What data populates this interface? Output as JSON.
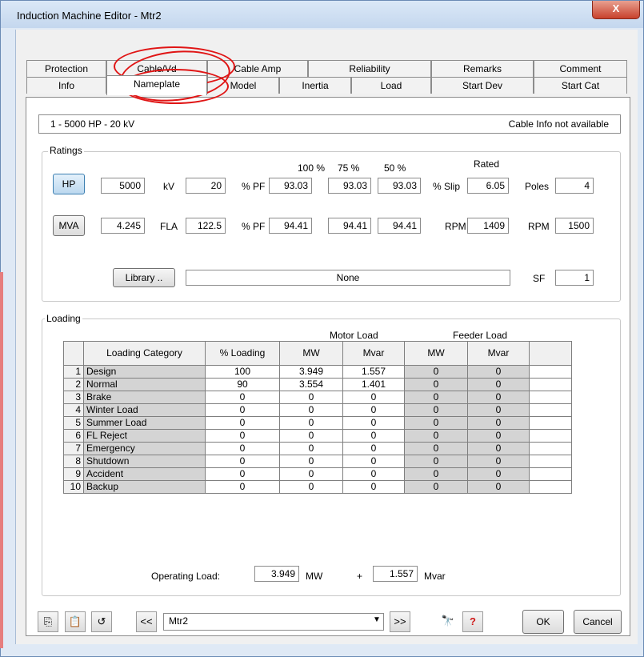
{
  "window": {
    "title": "Induction Machine Editor - Mtr2",
    "close_label": "X"
  },
  "tabs_row1": [
    "Protection",
    "Cable/Vd",
    "Cable Amp",
    "Reliability",
    "Remarks",
    "Comment"
  ],
  "tabs_row2": [
    "Info",
    "Nameplate",
    "Model",
    "Inertia",
    "Load",
    "Start Dev",
    "Start Cat"
  ],
  "active_tab": "Nameplate",
  "info_bar": {
    "left": "1 - 5000 HP - 20 kV",
    "right": "Cable Info not available"
  },
  "ratings": {
    "label": "Ratings",
    "hp_button": "HP",
    "hp_value": "5000",
    "kv_label": "kV",
    "kv_value": "20",
    "col_100": "100 %",
    "col_75": "75 %",
    "col_50": "50 %",
    "rated_label": "Rated",
    "pf_eff_label": "% PF",
    "eff_100": "93.03",
    "eff_75": "93.03",
    "eff_50": "93.03",
    "slip_label": "% Slip",
    "slip_value": "6.05",
    "poles_label": "Poles",
    "poles_value": "4",
    "mva_button": "MVA",
    "mva_value": "4.245",
    "fla_label": "FLA",
    "fla_value": "122.5",
    "pf_label": "% PF",
    "pf_100": "94.41",
    "pf_75": "94.41",
    "pf_50": "94.41",
    "rpm_label": "RPM",
    "rpm_value": "1409",
    "sync_rpm_label": "RPM",
    "sync_rpm_value": "1500",
    "library_button": "Library ..",
    "library_value": "None",
    "sf_label": "SF",
    "sf_value": "1"
  },
  "loading": {
    "label": "Loading",
    "motor_load_label": "Motor Load",
    "feeder_load_label": "Feeder Load",
    "columns": [
      "Loading Category",
      "% Loading",
      "MW",
      "Mvar",
      "MW",
      "Mvar"
    ],
    "rows": [
      {
        "n": "1",
        "cat": "Design",
        "pct": "100",
        "mw": "3.949",
        "mvar": "1.557",
        "fmw": "0",
        "fmvar": "0"
      },
      {
        "n": "2",
        "cat": "Normal",
        "pct": "90",
        "mw": "3.554",
        "mvar": "1.401",
        "fmw": "0",
        "fmvar": "0"
      },
      {
        "n": "3",
        "cat": "Brake",
        "pct": "0",
        "mw": "0",
        "mvar": "0",
        "fmw": "0",
        "fmvar": "0"
      },
      {
        "n": "4",
        "cat": "Winter Load",
        "pct": "0",
        "mw": "0",
        "mvar": "0",
        "fmw": "0",
        "fmvar": "0"
      },
      {
        "n": "5",
        "cat": "Summer Load",
        "pct": "0",
        "mw": "0",
        "mvar": "0",
        "fmw": "0",
        "fmvar": "0"
      },
      {
        "n": "6",
        "cat": "FL Reject",
        "pct": "0",
        "mw": "0",
        "mvar": "0",
        "fmw": "0",
        "fmvar": "0"
      },
      {
        "n": "7",
        "cat": "Emergency",
        "pct": "0",
        "mw": "0",
        "mvar": "0",
        "fmw": "0",
        "fmvar": "0"
      },
      {
        "n": "8",
        "cat": "Shutdown",
        "pct": "0",
        "mw": "0",
        "mvar": "0",
        "fmw": "0",
        "fmvar": "0"
      },
      {
        "n": "9",
        "cat": "Accident",
        "pct": "0",
        "mw": "0",
        "mvar": "0",
        "fmw": "0",
        "fmvar": "0"
      },
      {
        "n": "10",
        "cat": "Backup",
        "pct": "0",
        "mw": "0",
        "mvar": "0",
        "fmw": "0",
        "fmvar": "0"
      }
    ],
    "operating_label": "Operating Load:",
    "op_mw": "3.949",
    "mw_unit": "MW",
    "plus": "+",
    "op_mvar": "1.557",
    "mvar_unit": "Mvar"
  },
  "footer": {
    "element_name": "Mtr2",
    "ok_label": "OK",
    "cancel_label": "Cancel",
    "help_glyph": "?"
  },
  "colors": {
    "annotation_red": "#e01515",
    "grid_gray": "#d4d4d4"
  }
}
